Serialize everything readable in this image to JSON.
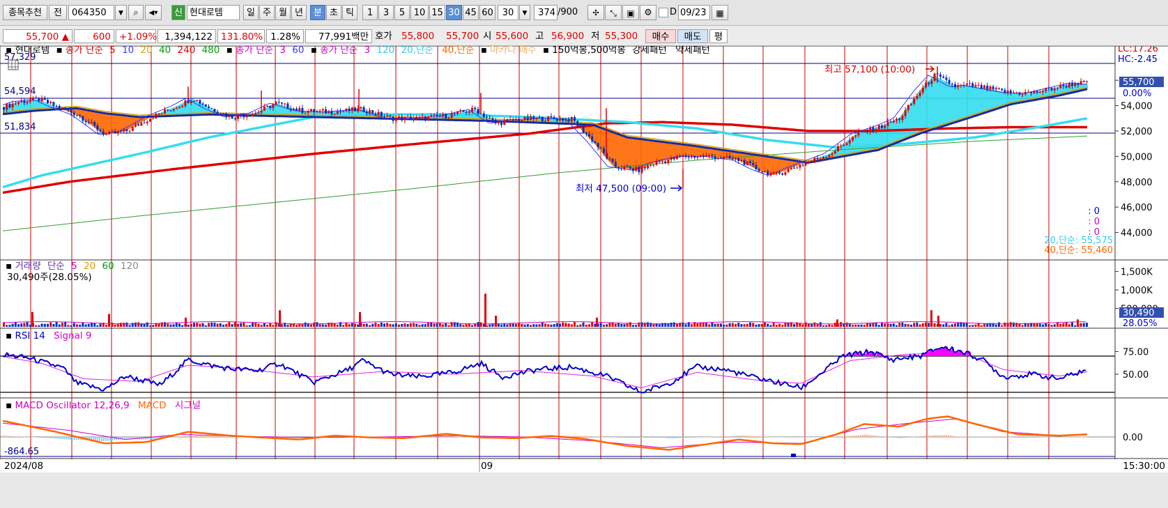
{
  "toolbar": {
    "recommend_label": "종목추천",
    "prev_label": "전",
    "stock_code": "064350",
    "new_label": "신",
    "stock_name": "현대로템",
    "period_buttons": [
      "일",
      "주",
      "월",
      "년",
      "분",
      "초",
      "틱"
    ],
    "interval_buttons": [
      "1",
      "3",
      "5",
      "10",
      "15",
      "30",
      "45",
      "60"
    ],
    "interval_select": "30",
    "count_value": "374",
    "count_total": "/900",
    "d_label": "D",
    "date_value": "09/23"
  },
  "quote": {
    "price": "55,700",
    "arrow": "▲",
    "change": "600",
    "change_pct": "+1.09%",
    "volume": "1,394,122",
    "volume_ratio": "131.80%",
    "turnover": "1.28%",
    "amount": "77,991백만",
    "hoga_label": "호가",
    "ask": "55,800",
    "bid": "55,700",
    "open_label": "시",
    "open": "55,600",
    "high_label": "고",
    "high": "56,900",
    "low_label": "저",
    "low": "55,300",
    "buy_button": "매수",
    "sell_button": "매도",
    "eval_button": "평"
  },
  "colors": {
    "price_up": "#e00000",
    "price_down": "#0030c0",
    "ma5": "#3a3aff",
    "ma20": "#e0a000",
    "ma40": "#00a000",
    "ma240": "#e00000",
    "ma480": "#00a000",
    "ribbon_cyan": "#33ddee",
    "ribbon_orange": "#ff6600",
    "rsi": "#0000cc",
    "rsi_signal": "#e020e0",
    "macd": "#ff6600",
    "signal": "#cc00cc",
    "grid_vertical": "#d00000",
    "grid_horizontal": "#00008b"
  },
  "legend": {
    "stock": "현대로템",
    "ma_label": "종가 단순",
    "ma_periods": [
      "5",
      "10",
      "20",
      "40",
      "240",
      "480"
    ],
    "ma2_label": "종가 단순",
    "ma2_periods": [
      "3",
      "60"
    ],
    "ma3_label": "종가 단순",
    "ma3_periods": [
      "3",
      "120"
    ],
    "ma20_label": "20,단순",
    "ma40_label": "40,단순",
    "macd_buy": "마카다 매수",
    "patterns": "150억봉,500억봉",
    "strong": "강세패턴",
    "weak": "약세패턴"
  },
  "chart_data": [
    {
      "type": "candlestick",
      "title": "현대로템",
      "ylim": [
        43000,
        57800
      ],
      "y_ticks": [
        "56,000",
        "54,000",
        "52,000",
        "50,000",
        "48,000",
        "46,000",
        "44,000"
      ],
      "x_labels": [
        "2024/08",
        "09"
      ],
      "time_label": "15:30:00",
      "left_levels": [
        "57,329",
        "54,594",
        "51,834"
      ],
      "lc": "LC:17.26",
      "hc": "HC:-2.45",
      "current_price": "55,700",
      "current_pct": "0.00%",
      "high_annotation": "최고 57,100 (10:00)",
      "low_annotation": "최저 47,500 (09:00)",
      "indicator_zero": [
        ": 0",
        ": 0",
        ": 0"
      ],
      "ma20_value": "20,단순: 55,575",
      "ma40_value": "40,단순: 55,460",
      "price_anchors": [
        [
          0,
          53800
        ],
        [
          25,
          54300
        ],
        [
          55,
          54500
        ],
        [
          80,
          53900
        ],
        [
          110,
          53300
        ],
        [
          150,
          51700
        ],
        [
          180,
          52000
        ],
        [
          220,
          53200
        ],
        [
          255,
          54000
        ],
        [
          275,
          54600
        ],
        [
          300,
          53800
        ],
        [
          330,
          53100
        ],
        [
          365,
          53400
        ],
        [
          395,
          54200
        ],
        [
          430,
          53600
        ],
        [
          470,
          53500
        ],
        [
          520,
          53700
        ],
        [
          560,
          53000
        ],
        [
          600,
          53000
        ],
        [
          640,
          53200
        ],
        [
          680,
          53700
        ],
        [
          710,
          52600
        ],
        [
          740,
          52900
        ],
        [
          790,
          53000
        ],
        [
          820,
          52900
        ],
        [
          850,
          51200
        ],
        [
          880,
          49200
        ],
        [
          915,
          48900
        ],
        [
          940,
          49500
        ],
        [
          980,
          50000
        ],
        [
          1020,
          50000
        ],
        [
          1060,
          49700
        ],
        [
          1085,
          49000
        ],
        [
          1110,
          48500
        ],
        [
          1150,
          49400
        ],
        [
          1190,
          50200
        ],
        [
          1230,
          51800
        ],
        [
          1260,
          52300
        ],
        [
          1290,
          53000
        ],
        [
          1320,
          55200
        ],
        [
          1340,
          56400
        ],
        [
          1370,
          55500
        ],
        [
          1390,
          55600
        ],
        [
          1420,
          55300
        ],
        [
          1450,
          55000
        ],
        [
          1480,
          55000
        ],
        [
          1520,
          55500
        ],
        [
          1545,
          55800
        ],
        [
          1560,
          55700
        ]
      ],
      "ma_blue_anchors": [
        [
          0,
          53300
        ],
        [
          50,
          53600
        ],
        [
          110,
          53800
        ],
        [
          150,
          53400
        ],
        [
          200,
          53100
        ],
        [
          300,
          53300
        ],
        [
          450,
          53100
        ],
        [
          700,
          52800
        ],
        [
          850,
          52500
        ],
        [
          900,
          51500
        ],
        [
          1000,
          50800
        ],
        [
          1100,
          50000
        ],
        [
          1160,
          49500
        ],
        [
          1260,
          50500
        ],
        [
          1320,
          51800
        ],
        [
          1400,
          53200
        ],
        [
          1450,
          54100
        ],
        [
          1520,
          54800
        ],
        [
          1560,
          55300
        ]
      ],
      "ma_cyan_anchors": [
        [
          0,
          47500
        ],
        [
          60,
          48500
        ],
        [
          200,
          50200
        ],
        [
          300,
          51500
        ],
        [
          450,
          53100
        ],
        [
          550,
          53300
        ],
        [
          650,
          53300
        ],
        [
          760,
          53100
        ],
        [
          900,
          52700
        ],
        [
          1000,
          52200
        ],
        [
          1100,
          51300
        ],
        [
          1200,
          50700
        ],
        [
          1300,
          51000
        ],
        [
          1400,
          51500
        ],
        [
          1500,
          52400
        ],
        [
          1560,
          53000
        ]
      ],
      "ma_red_anchors": [
        [
          0,
          47100
        ],
        [
          100,
          48000
        ],
        [
          250,
          49000
        ],
        [
          450,
          50200
        ],
        [
          600,
          51000
        ],
        [
          760,
          51800
        ],
        [
          870,
          52600
        ],
        [
          950,
          52700
        ],
        [
          1050,
          52500
        ],
        [
          1160,
          52000
        ],
        [
          1250,
          52000
        ],
        [
          1360,
          52200
        ],
        [
          1450,
          52300
        ],
        [
          1560,
          52300
        ]
      ],
      "ma_green_anchors": [
        [
          0,
          44100
        ],
        [
          200,
          45300
        ],
        [
          400,
          46400
        ],
        [
          600,
          47500
        ],
        [
          800,
          48700
        ],
        [
          1000,
          49700
        ],
        [
          1200,
          50500
        ],
        [
          1400,
          51200
        ],
        [
          1560,
          51600
        ]
      ]
    },
    {
      "type": "bar",
      "title": "거래량",
      "series_label": "단순",
      "periods": [
        "5",
        "20",
        "60",
        "120"
      ],
      "current_text": "30,490주(28.05%)",
      "y_ticks": [
        "1,500K",
        "1,000K",
        "500,000"
      ],
      "current_volume": "30,490",
      "current_pct": "28.05%",
      "spike_bars": [
        [
          45,
          400000
        ],
        [
          155,
          350000
        ],
        [
          265,
          250000
        ],
        [
          400,
          450000
        ],
        [
          515,
          400000
        ],
        [
          695,
          900000
        ],
        [
          710,
          300000
        ],
        [
          855,
          250000
        ],
        [
          1200,
          200000
        ],
        [
          1335,
          450000
        ],
        [
          1345,
          300000
        ],
        [
          1545,
          200000
        ]
      ]
    },
    {
      "type": "line",
      "title": "RSI",
      "series": [
        {
          "name": "RSI 14"
        },
        {
          "name": "Signal 9"
        }
      ],
      "y_ticks": [
        "75.00",
        "50.00"
      ],
      "ylim": [
        20,
        95
      ],
      "upper": 70,
      "lower": 30,
      "rsi_anchors": [
        [
          0,
          72
        ],
        [
          40,
          68
        ],
        [
          90,
          57
        ],
        [
          110,
          40
        ],
        [
          150,
          33
        ],
        [
          180,
          48
        ],
        [
          230,
          38
        ],
        [
          270,
          66
        ],
        [
          300,
          60
        ],
        [
          330,
          56
        ],
        [
          370,
          54
        ],
        [
          400,
          62
        ],
        [
          450,
          41
        ],
        [
          500,
          55
        ],
        [
          520,
          65
        ],
        [
          560,
          50
        ],
        [
          600,
          47
        ],
        [
          650,
          52
        ],
        [
          690,
          62
        ],
        [
          720,
          47
        ],
        [
          770,
          55
        ],
        [
          820,
          58
        ],
        [
          870,
          48
        ],
        [
          920,
          30
        ],
        [
          960,
          40
        ],
        [
          1000,
          58
        ],
        [
          1040,
          55
        ],
        [
          1080,
          47
        ],
        [
          1120,
          40
        ],
        [
          1150,
          35
        ],
        [
          1180,
          52
        ],
        [
          1210,
          70
        ],
        [
          1250,
          75
        ],
        [
          1280,
          66
        ],
        [
          1320,
          70
        ],
        [
          1350,
          80
        ],
        [
          1380,
          75
        ],
        [
          1410,
          66
        ],
        [
          1440,
          47
        ],
        [
          1480,
          50
        ],
        [
          1520,
          45
        ],
        [
          1560,
          55
        ],
        [
          1580,
          52
        ]
      ],
      "signal_anchors": [
        [
          0,
          70
        ],
        [
          60,
          62
        ],
        [
          120,
          45
        ],
        [
          200,
          42
        ],
        [
          270,
          60
        ],
        [
          350,
          56
        ],
        [
          450,
          47
        ],
        [
          550,
          53
        ],
        [
          650,
          50
        ],
        [
          750,
          54
        ],
        [
          850,
          48
        ],
        [
          920,
          35
        ],
        [
          1000,
          52
        ],
        [
          1100,
          42
        ],
        [
          1150,
          40
        ],
        [
          1220,
          65
        ],
        [
          1300,
          72
        ],
        [
          1380,
          74
        ],
        [
          1440,
          55
        ],
        [
          1520,
          48
        ],
        [
          1580,
          55
        ]
      ]
    },
    {
      "type": "line",
      "title": "MACD Oscillator",
      "series": [
        {
          "name": "MACD Oscillator 12,26,9"
        },
        {
          "name": "MACD"
        },
        {
          "name": "시그널"
        }
      ],
      "zero_label": "0.00",
      "min_label": "-864.65",
      "ylim": [
        -900,
        1300
      ],
      "macd_anchors": [
        [
          0,
          650
        ],
        [
          80,
          200
        ],
        [
          150,
          -250
        ],
        [
          210,
          -200
        ],
        [
          270,
          200
        ],
        [
          330,
          50
        ],
        [
          380,
          -30
        ],
        [
          430,
          -100
        ],
        [
          480,
          50
        ],
        [
          530,
          -20
        ],
        [
          580,
          -50
        ],
        [
          640,
          120
        ],
        [
          690,
          -20
        ],
        [
          740,
          -50
        ],
        [
          790,
          40
        ],
        [
          840,
          -80
        ],
        [
          900,
          -350
        ],
        [
          960,
          -500
        ],
        [
          1010,
          -300
        ],
        [
          1060,
          -100
        ],
        [
          1110,
          -250
        ],
        [
          1150,
          -280
        ],
        [
          1200,
          100
        ],
        [
          1240,
          500
        ],
        [
          1290,
          400
        ],
        [
          1330,
          700
        ],
        [
          1360,
          800
        ],
        [
          1400,
          500
        ],
        [
          1460,
          100
        ],
        [
          1520,
          50
        ],
        [
          1560,
          100
        ]
      ],
      "signal_anchors": [
        [
          0,
          550
        ],
        [
          100,
          250
        ],
        [
          180,
          -100
        ],
        [
          260,
          100
        ],
        [
          350,
          20
        ],
        [
          450,
          -20
        ],
        [
          550,
          0
        ],
        [
          650,
          50
        ],
        [
          750,
          0
        ],
        [
          850,
          -150
        ],
        [
          950,
          -420
        ],
        [
          1050,
          -200
        ],
        [
          1150,
          -250
        ],
        [
          1230,
          300
        ],
        [
          1300,
          520
        ],
        [
          1370,
          700
        ],
        [
          1440,
          200
        ],
        [
          1520,
          50
        ],
        [
          1560,
          80
        ]
      ]
    }
  ]
}
